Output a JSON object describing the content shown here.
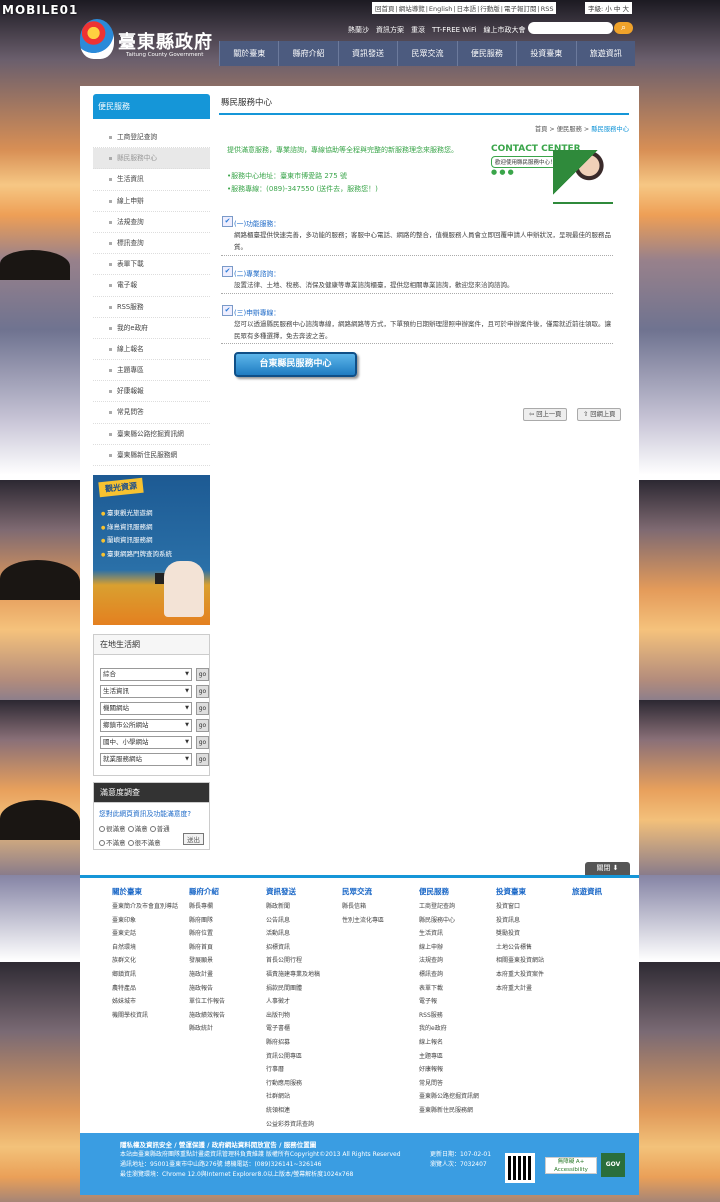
{
  "watermark": "MOBILE01",
  "top_links": [
    "回首頁",
    "網站導覽",
    "English",
    "日本語",
    "行動版",
    "電子報訂閱",
    "RSS"
  ],
  "font_size": {
    "label": "字級:",
    "options": [
      "小",
      "中",
      "大"
    ]
  },
  "top_links2": [
    "熱蘭沙",
    "資訊方案",
    "重滾",
    "TT-FREE WiFi",
    "線上市政大會"
  ],
  "site": {
    "name": "臺東縣政府",
    "name_en": "Taitung County Government"
  },
  "nav": [
    "關於臺東",
    "縣府介紹",
    "資訊發送",
    "民眾交流",
    "便民服務",
    "投資臺東",
    "旅遊資訊"
  ],
  "sidebar": {
    "title": "便民服務",
    "items": [
      "工商登記查詢",
      "縣民服務中心",
      "生活資訊",
      "線上申辦",
      "法規查詢",
      "標訊查詢",
      "表單下載",
      "電子報",
      "RSS服務",
      "我的e政府",
      "線上報名",
      "主題專區",
      "好康報報",
      "常見問答",
      "臺東縣公路挖掘資訊網",
      "臺東縣新住民服務網"
    ]
  },
  "promo": {
    "title": "觀光資源",
    "items": [
      "臺東觀光旅遊網",
      "綠島資訊服務網",
      "蘭嶼資訊服務網",
      "臺東網路門牌查詢系統"
    ]
  },
  "local": {
    "title": "在地生活網",
    "selects": [
      "綜合",
      "生活資訊",
      "機關網站",
      "鄉鎮市公所網站",
      "國中、小學網站",
      "就業服務網站"
    ],
    "go": "go"
  },
  "poll": {
    "title": "滿意度調查",
    "question": "您對此網頁資訊及功能滿意度?",
    "options": [
      "很滿意",
      "滿意",
      "普通",
      "不滿意",
      "很不滿意"
    ],
    "button": "送出"
  },
  "content": {
    "title": "縣民服務中心",
    "breadcrumb": [
      "首頁",
      ">",
      "便民服務",
      ">"
    ],
    "breadcrumb_current": "縣民服務中心",
    "intro": "提供滿意服務，專業諮詢，專線協助等全程與完整的新服務理念來服務您。",
    "address": "•服務中心地址：臺東市博愛路 275 號",
    "phone": "•服務專線：(089)-347550 (送件去，服務您！)",
    "contact_title": "CONTACT CENTER",
    "contact_sub": "歡迎使用縣民服務中心！",
    "contact_dots": "● ● ●",
    "sections": [
      {
        "h": "(一)功能服務：",
        "b": "網路櫃臺提供快速完善，多功能的服務；客服中心電話、網路的整合，值機服務人員會立即回覆申請人申辦狀況，呈現最佳的服務品質。"
      },
      {
        "h": "(二)專業諮詢：",
        "b": "設置法律、土地、稅務、消保及健康等專業諮詢櫃臺，提供您相關專業諮詢，歡迎您來洽詢諮詢。"
      },
      {
        "h": "(三)申辦專線：",
        "b": "您可以透過縣民服務中心諮詢專線，網路網路等方式，下單預約日期辦理證照申辦案件，且可於申辦案件後，僅需就近前往領取。讓民眾有多種選擇，免去奔波之苦。"
      }
    ],
    "big_button": "台東縣民服務中心",
    "prev": "回上一頁",
    "top": "回網上頁"
  },
  "footer_toggle": "關閉",
  "footer_cols": [
    {
      "h": "關於臺東",
      "items": [
        "臺東簡介及市會直別導話",
        "臺東印象",
        "臺東史話",
        "自然環境",
        "族群文化",
        "鄉鎮資訊",
        "農特產品",
        "姊妹城市",
        "機關學校資訊"
      ]
    },
    {
      "h": "縣府介紹",
      "items": [
        "縣長專欄",
        "縣府團隊",
        "縣府位置",
        "縣府首頁",
        "發展願景",
        "施政計畫",
        "施政報告",
        "單位工作報告",
        "施政績效報告",
        "縣政統計"
      ]
    },
    {
      "h": "資訊發送",
      "items": [
        "縣政新聞",
        "公告訊息",
        "活動訊息",
        "招標資訊",
        "首長公開行程",
        "福責施建專業及地稿",
        "捐款民間團體",
        "人事徵才",
        "出版刊物",
        "電子書櫃",
        "縣府招募",
        "資訊公開專區",
        "行事曆",
        "行動應用服務",
        "社群網站",
        "統領相連",
        "公益彩券資訊查詢"
      ]
    },
    {
      "h": "民眾交流",
      "items": [
        "縣長信箱",
        "性別主流化專區"
      ]
    },
    {
      "h": "便民服務",
      "items": [
        "工商登記查詢",
        "縣民服務中心",
        "生活資訊",
        "線上申辦",
        "法規查詢",
        "標訊查詢",
        "表單下載",
        "電子報",
        "RSS服務",
        "我的e政府",
        "線上報名",
        "主題專區",
        "好康報報",
        "常見問答",
        "臺東縣公路挖掘資訊網",
        "臺東縣新住民服務網"
      ]
    },
    {
      "h": "投資臺東",
      "items": [
        "投資窗口",
        "投資訊息",
        "獎勵投資",
        "土地公告標售",
        "相關臺東投資網站",
        "本府重大投資案件",
        "本府重大計畫"
      ]
    },
    {
      "h": "旅遊資訊",
      "items": []
    }
  ],
  "copyright": {
    "line1": "隱私權及資訊安全 / 營運保護 / 政府網站資料開放宣告 / 服務位置圖",
    "line2": "本站由臺東縣政府團隊重點計畫處資訊管理科負責維護   版權所有Copyright©2013 All Rights Reserved",
    "line3": "通訊地址：95001臺東市中山路276號   總機電話：(089)326141~326146",
    "line4": "最佳瀏覽環境：Chrome 12.0與Internet Explorer8.0以上版本/螢幕解析度1024x768",
    "update": "更新日期：107-02-01",
    "visitors": "瀏覽人次：7032407",
    "badge1": "無障礙 A+ Accessibility",
    "badge2": "GOV"
  }
}
